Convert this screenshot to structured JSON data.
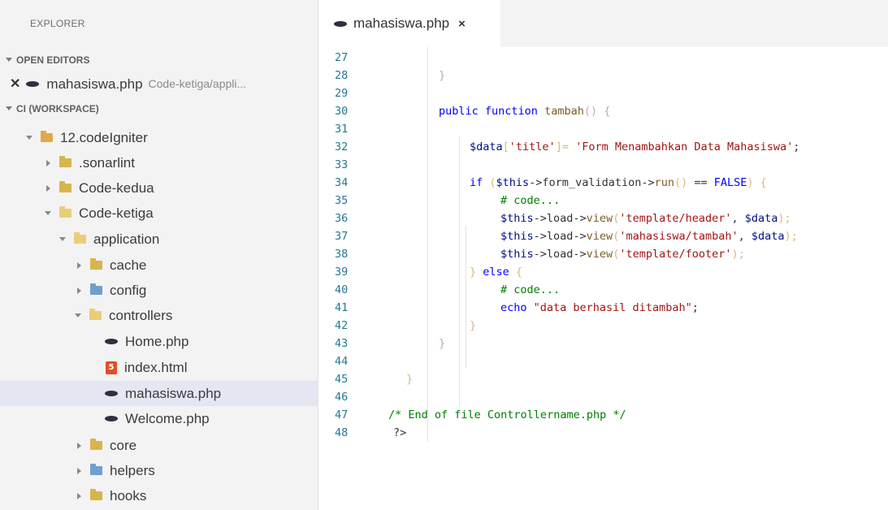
{
  "sidebar": {
    "title": "EXPLORER",
    "open_editors_header": "OPEN EDITORS",
    "workspace_header": "CI (WORKSPACE)",
    "open_editors": [
      {
        "name": "mahasiswa.php",
        "path": "Code-ketiga/appli..."
      }
    ],
    "tree": [
      {
        "label": "12.codeIgniter"
      },
      {
        "label": ".sonarlint"
      },
      {
        "label": "Code-kedua"
      },
      {
        "label": "Code-ketiga"
      },
      {
        "label": "application"
      },
      {
        "label": "cache"
      },
      {
        "label": "config"
      },
      {
        "label": "controllers"
      },
      {
        "label": "Home.php"
      },
      {
        "label": "index.html"
      },
      {
        "label": "mahasiswa.php"
      },
      {
        "label": "Welcome.php"
      },
      {
        "label": "core"
      },
      {
        "label": "helpers"
      },
      {
        "label": "hooks"
      }
    ]
  },
  "editor": {
    "tab": {
      "label": "mahasiswa.php",
      "close": "×"
    },
    "line_numbers": [
      "27",
      "28",
      "29",
      "30",
      "31",
      "32",
      "33",
      "34",
      "35",
      "36",
      "37",
      "38",
      "39",
      "40",
      "41",
      "42",
      "43",
      "44",
      "45",
      "46",
      "47",
      "48"
    ],
    "code": {
      "l28": "}",
      "l30_kw": "public function",
      "l30_fn": "tambah",
      "l30_rest": "() {",
      "l32_var": "$data",
      "l32_a": "[",
      "l32_key": "'title'",
      "l32_b": "]= ",
      "l32_str": "'Form Menambahkan Data Mahasiswa'",
      "l32_end": ";",
      "l34_kw": "if",
      "l34_a": " (",
      "l34_var": "$this",
      "l34_b": "->form_validation->",
      "l34_fn": "run",
      "l34_c": "()",
      "l34_d": " == ",
      "l34_kw2": "FALSE",
      "l34_e": ") {",
      "l35": "# code...",
      "l36_var": "$this",
      "l36_a": "->load->",
      "l36_fn": "view",
      "l36_b": "(",
      "l36_str": "'template/header'",
      "l36_c": ", ",
      "l36_var2": "$data",
      "l36_d": ");",
      "l37_var": "$this",
      "l37_a": "->load->",
      "l37_fn": "view",
      "l37_b": "(",
      "l37_str": "'mahasiswa/tambah'",
      "l37_c": ", ",
      "l37_var2": "$data",
      "l37_d": ");",
      "l38_var": "$this",
      "l38_a": "->load->",
      "l38_fn": "view",
      "l38_b": "(",
      "l38_str": "'template/footer'",
      "l38_d": ");",
      "l39_a": "} ",
      "l39_kw": "else",
      "l39_b": " {",
      "l40": "# code...",
      "l41_kw": "echo",
      "l41_str": " \"data berhasil ditambah\"",
      "l41_end": ";",
      "l42": "}",
      "l43": "}",
      "l45": "}",
      "l47": "/* End of file Controllername.php */",
      "l48": "?>"
    }
  },
  "colors": {
    "line_number": "#237893",
    "keyword": "#0000ff",
    "string": "#a31515",
    "comment": "#008000",
    "selected_row": "#e4e6f1",
    "sidebar_bg": "#f3f3f3"
  }
}
